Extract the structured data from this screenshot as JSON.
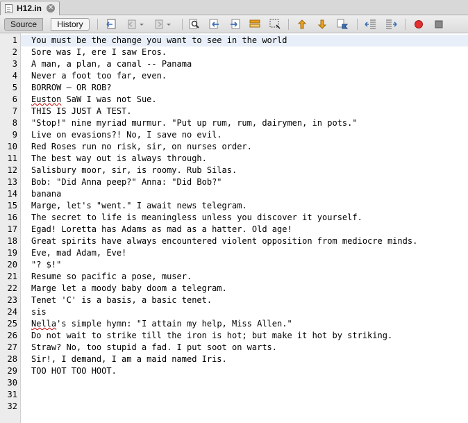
{
  "tab": {
    "title": "H12.in",
    "close_glyph": "✕"
  },
  "toolbar": {
    "source_label": "Source",
    "history_label": "History",
    "icons": [
      "back-to-last-edit-icon",
      "back-icon",
      "forward-icon",
      "find-icon",
      "find-previous-icon",
      "find-next-icon",
      "toggle-highlight-icon",
      "toggle-rect-selection-icon",
      "previous-bookmark-icon",
      "next-bookmark-icon",
      "toggle-bookmark-icon",
      "shift-left-icon",
      "shift-right-icon",
      "start-macro-icon",
      "stop-macro-icon"
    ],
    "colors": {
      "record": "#e53030",
      "stop": "#888888",
      "arrow_orange": "#e8a020",
      "arrow_blue": "#3d6fb8"
    }
  },
  "editor": {
    "current_line": 1,
    "squiggle_words": {
      "6": "Euston",
      "25": "Nella"
    },
    "lines": [
      "You must be the change you want to see in the world",
      "Sore was I, ere I saw Eros.",
      "A man, a plan, a canal -- Panama",
      "Never a foot too far, even.",
      "BORROW – OR ROB?",
      "Euston SaW I was not Sue.",
      "THIS IS JUST A TEST.",
      "\"Stop!\" nine myriad murmur. \"Put up rum, rum, dairymen, in pots.\"",
      "Live on evasions?! No, I save no evil.",
      "Red Roses run no risk, sir, on nurses order.",
      "The best way out is always through.",
      "Salisbury moor, sir, is roomy. Rub Silas.",
      "Bob: \"Did Anna peep?\" Anna: \"Did Bob?\"",
      "banana",
      "Marge, let's \"went.\" I await news telegram.",
      "The secret to life is meaningless unless you discover it yourself.",
      "Egad! Loretta has Adams as mad as a hatter. Old age!",
      "Great spirits have always encountered violent opposition from mediocre minds.",
      "Eve, mad Adam, Eve!",
      "\"? $!\"",
      "Resume so pacific a pose, muser.",
      "Marge let a moody baby doom a telegram.",
      "Tenet 'C' is a basis, a basic tenet.",
      "sis",
      "Nella's simple hymn: \"I attain my help, Miss Allen.\"",
      "Do not wait to strike till the iron is hot; but make it hot by striking.",
      "Straw? No, too stupid a fad. I put soot on warts.",
      "Sir!, I demand, I am a maid named Iris.",
      "TOO HOT TOO HOOT.",
      "",
      "",
      ""
    ],
    "line_numbers": [
      "1",
      "2",
      "3",
      "4",
      "5",
      "6",
      "7",
      "8",
      "9",
      "10",
      "11",
      "12",
      "13",
      "14",
      "15",
      "16",
      "17",
      "18",
      "19",
      "20",
      "21",
      "22",
      "23",
      "24",
      "25",
      "26",
      "27",
      "28",
      "29",
      "30",
      "31",
      "32"
    ]
  }
}
